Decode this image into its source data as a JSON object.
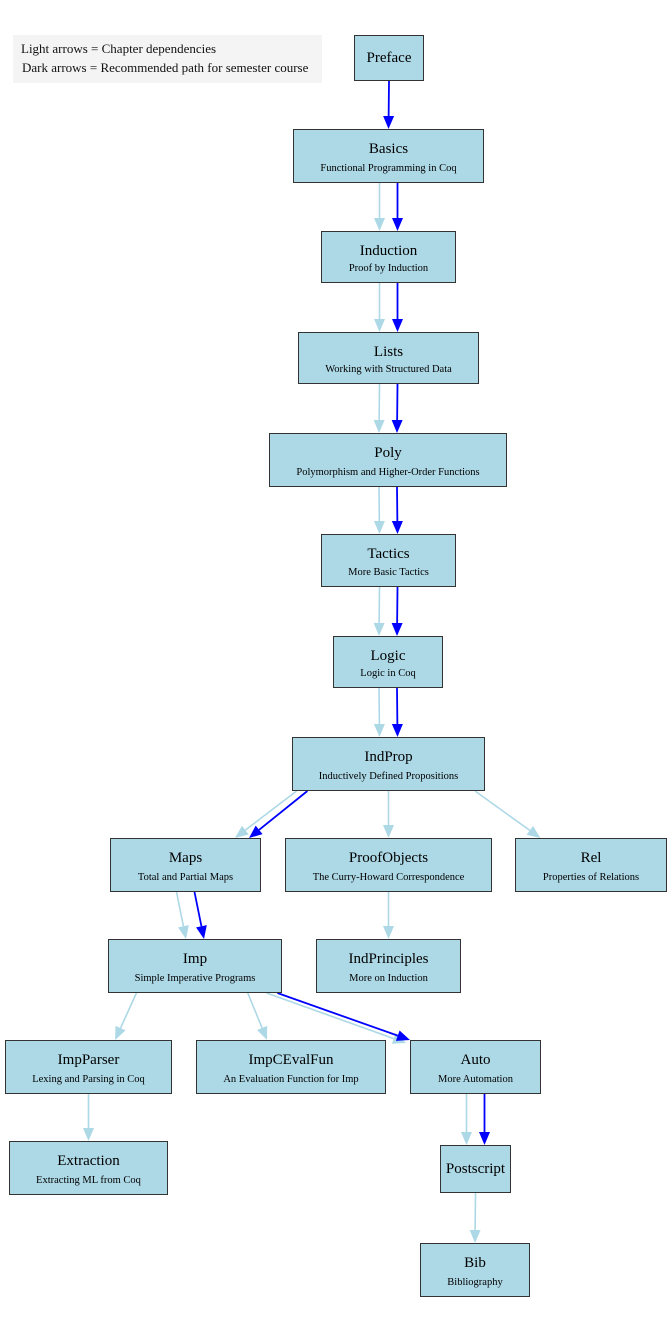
{
  "legend": {
    "line1": "Light arrows = Chapter dependencies",
    "line2": "Dark arrows = Recommended path for semester course"
  },
  "colors": {
    "node_fill": "#add8e6",
    "node_border": "#333333",
    "dependency_arrow": "#add8e6",
    "recommended_arrow": "#0000ff",
    "legend_bg": "#f4f4f4"
  },
  "nodes": {
    "preface": {
      "title": "Preface",
      "subtitle": ""
    },
    "basics": {
      "title": "Basics",
      "subtitle": "Functional Programming in Coq"
    },
    "induction": {
      "title": "Induction",
      "subtitle": "Proof by Induction"
    },
    "lists": {
      "title": "Lists",
      "subtitle": "Working with Structured Data"
    },
    "poly": {
      "title": "Poly",
      "subtitle": "Polymorphism and Higher-Order Functions"
    },
    "tactics": {
      "title": "Tactics",
      "subtitle": "More Basic Tactics"
    },
    "logic": {
      "title": "Logic",
      "subtitle": "Logic in Coq"
    },
    "indprop": {
      "title": "IndProp",
      "subtitle": "Inductively Defined Propositions"
    },
    "maps": {
      "title": "Maps",
      "subtitle": "Total and Partial Maps"
    },
    "proofobjects": {
      "title": "ProofObjects",
      "subtitle": "The Curry-Howard Correspondence"
    },
    "rel": {
      "title": "Rel",
      "subtitle": "Properties of Relations"
    },
    "imp": {
      "title": "Imp",
      "subtitle": "Simple Imperative Programs"
    },
    "indprinciples": {
      "title": "IndPrinciples",
      "subtitle": "More on Induction"
    },
    "impparser": {
      "title": "ImpParser",
      "subtitle": "Lexing and Parsing in Coq"
    },
    "impcevalfun": {
      "title": "ImpCEvalFun",
      "subtitle": "An Evaluation Function for Imp"
    },
    "auto": {
      "title": "Auto",
      "subtitle": "More Automation"
    },
    "extraction": {
      "title": "Extraction",
      "subtitle": "Extracting ML from Coq"
    },
    "postscript": {
      "title": "Postscript",
      "subtitle": ""
    },
    "bib": {
      "title": "Bib",
      "subtitle": "Bibliography"
    }
  },
  "edges": [
    {
      "from": "preface",
      "to": "basics",
      "kind": "recommended"
    },
    {
      "from": "basics",
      "to": "induction",
      "kind": "dependency"
    },
    {
      "from": "basics",
      "to": "induction",
      "kind": "recommended"
    },
    {
      "from": "induction",
      "to": "lists",
      "kind": "dependency"
    },
    {
      "from": "induction",
      "to": "lists",
      "kind": "recommended"
    },
    {
      "from": "lists",
      "to": "poly",
      "kind": "dependency"
    },
    {
      "from": "lists",
      "to": "poly",
      "kind": "recommended"
    },
    {
      "from": "poly",
      "to": "tactics",
      "kind": "dependency"
    },
    {
      "from": "poly",
      "to": "tactics",
      "kind": "recommended"
    },
    {
      "from": "tactics",
      "to": "logic",
      "kind": "dependency"
    },
    {
      "from": "tactics",
      "to": "logic",
      "kind": "recommended"
    },
    {
      "from": "logic",
      "to": "indprop",
      "kind": "dependency"
    },
    {
      "from": "logic",
      "to": "indprop",
      "kind": "recommended"
    },
    {
      "from": "indprop",
      "to": "maps",
      "kind": "dependency"
    },
    {
      "from": "indprop",
      "to": "maps",
      "kind": "recommended"
    },
    {
      "from": "indprop",
      "to": "proofobjects",
      "kind": "dependency"
    },
    {
      "from": "indprop",
      "to": "rel",
      "kind": "dependency"
    },
    {
      "from": "maps",
      "to": "imp",
      "kind": "dependency"
    },
    {
      "from": "maps",
      "to": "imp",
      "kind": "recommended"
    },
    {
      "from": "proofobjects",
      "to": "indprinciples",
      "kind": "dependency"
    },
    {
      "from": "imp",
      "to": "impparser",
      "kind": "dependency"
    },
    {
      "from": "imp",
      "to": "impcevalfun",
      "kind": "dependency"
    },
    {
      "from": "imp",
      "to": "auto",
      "kind": "dependency"
    },
    {
      "from": "imp",
      "to": "auto",
      "kind": "recommended"
    },
    {
      "from": "impparser",
      "to": "extraction",
      "kind": "dependency"
    },
    {
      "from": "auto",
      "to": "postscript",
      "kind": "dependency"
    },
    {
      "from": "auto",
      "to": "postscript",
      "kind": "recommended"
    },
    {
      "from": "postscript",
      "to": "bib",
      "kind": "dependency"
    }
  ]
}
